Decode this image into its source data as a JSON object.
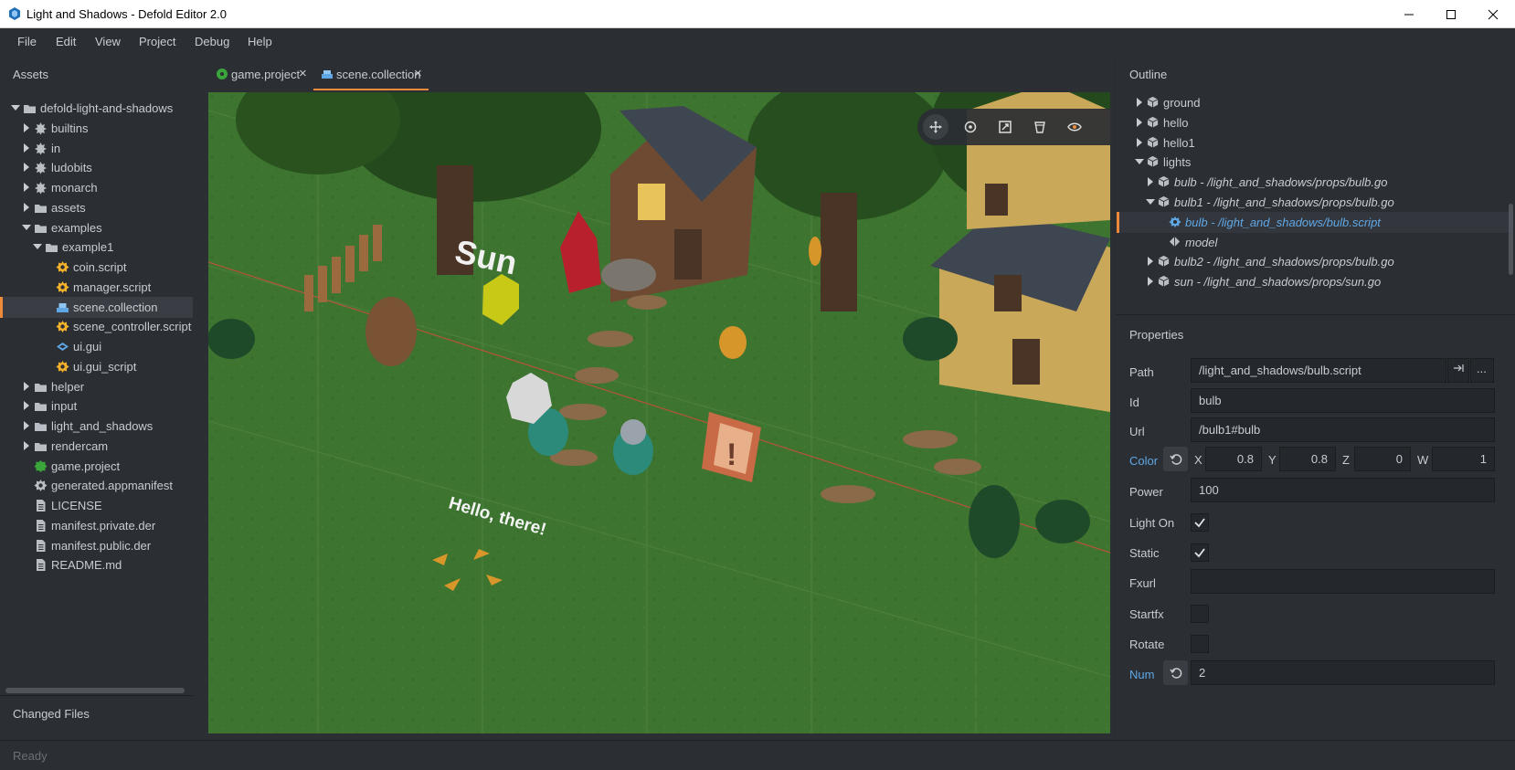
{
  "window": {
    "title": "Light and Shadows - Defold Editor 2.0"
  },
  "menu": [
    "File",
    "Edit",
    "View",
    "Project",
    "Debug",
    "Help"
  ],
  "assets": {
    "title": "Assets",
    "items": [
      {
        "label": "defold-light-and-shadows",
        "icon": "folder-icon",
        "expanded": true
      },
      {
        "label": "builtins",
        "icon": "library-icon"
      },
      {
        "label": "in",
        "icon": "library-icon"
      },
      {
        "label": "ludobits",
        "icon": "library-icon"
      },
      {
        "label": "monarch",
        "icon": "library-icon"
      },
      {
        "label": "assets",
        "icon": "folder-icon"
      },
      {
        "label": "examples",
        "icon": "folder-icon",
        "expanded": true
      },
      {
        "label": "example1",
        "icon": "folder-icon",
        "expanded": true
      },
      {
        "label": "coin.script",
        "icon": "script-icon"
      },
      {
        "label": "manager.script",
        "icon": "script-icon"
      },
      {
        "label": "scene.collection",
        "icon": "collection-icon",
        "selected": true
      },
      {
        "label": "scene_controller.script",
        "icon": "script-icon"
      },
      {
        "label": "ui.gui",
        "icon": "gui-icon"
      },
      {
        "label": "ui.gui_script",
        "icon": "script-icon"
      },
      {
        "label": "helper",
        "icon": "folder-icon"
      },
      {
        "label": "input",
        "icon": "folder-icon"
      },
      {
        "label": "light_and_shadows",
        "icon": "folder-icon"
      },
      {
        "label": "rendercam",
        "icon": "folder-icon"
      },
      {
        "label": "game.project",
        "icon": "project-icon"
      },
      {
        "label": "generated.appmanifest",
        "icon": "gear-icon"
      },
      {
        "label": "LICENSE",
        "icon": "file-icon"
      },
      {
        "label": "manifest.private.der",
        "icon": "file-icon"
      },
      {
        "label": "manifest.public.der",
        "icon": "file-icon"
      },
      {
        "label": "README.md",
        "icon": "file-icon"
      }
    ],
    "changed_files": "Changed Files"
  },
  "tabs": [
    {
      "label": "game.project",
      "icon": "project-icon",
      "active": false
    },
    {
      "label": "scene.collection",
      "icon": "collection-icon",
      "active": true
    }
  ],
  "scene": {
    "sun_label": "Sun",
    "hello_label": "Hello, there!",
    "tools": [
      "move-tool-icon",
      "rotate-tool-icon",
      "scale-tool-icon",
      "perspective-icon",
      "visibility-icon"
    ]
  },
  "outline": {
    "title": "Outline",
    "items": [
      {
        "label": "ground",
        "icon": "gameobject-icon",
        "italic": false
      },
      {
        "label": "hello",
        "icon": "gameobject-icon",
        "italic": false
      },
      {
        "label": "hello1",
        "icon": "gameobject-icon",
        "italic": false
      },
      {
        "label": "lights",
        "icon": "gameobject-icon",
        "italic": false,
        "expanded": true
      },
      {
        "label": "bulb - /light_and_shadows/props/bulb.go",
        "icon": "gameobject-icon",
        "italic": true
      },
      {
        "label": "bulb1 - /light_and_shadows/props/bulb.go",
        "icon": "gameobject-icon",
        "italic": true,
        "expanded": true
      },
      {
        "label": "bulb - /light_and_shadows/bulb.script",
        "icon": "script-icon",
        "italic": true,
        "selected": true
      },
      {
        "label": "model",
        "icon": "model-icon",
        "italic": true
      },
      {
        "label": "bulb2 - /light_and_shadows/props/bulb.go",
        "icon": "gameobject-icon",
        "italic": true
      },
      {
        "label": "sun - /light_and_shadows/props/sun.go",
        "icon": "gameobject-icon",
        "italic": true
      }
    ]
  },
  "properties": {
    "title": "Properties",
    "path": {
      "label": "Path",
      "value": "/light_and_shadows/bulb.script"
    },
    "id": {
      "label": "Id",
      "value": "bulb"
    },
    "url": {
      "label": "Url",
      "value": "/bulb1#bulb"
    },
    "color": {
      "label": "Color",
      "x": "0.8",
      "y": "0.8",
      "z": "0",
      "w": "1"
    },
    "axes": {
      "x": "X",
      "y": "Y",
      "z": "Z",
      "w": "W"
    },
    "power": {
      "label": "Power",
      "value": "100"
    },
    "light_on": {
      "label": "Light On",
      "checked": true
    },
    "static": {
      "label": "Static",
      "checked": true
    },
    "fxurl": {
      "label": "Fxurl",
      "value": ""
    },
    "startfx": {
      "label": "Startfx",
      "checked": false
    },
    "rotate": {
      "label": "Rotate",
      "checked": false
    },
    "num": {
      "label": "Num",
      "value": "2"
    },
    "path_more": "..."
  },
  "status": "Ready",
  "colors": {
    "accent": "#f08a3b",
    "link": "#5fa7e5",
    "panel": "#2b2e33"
  }
}
